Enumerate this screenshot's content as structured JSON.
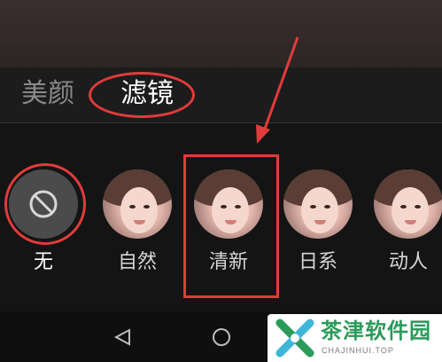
{
  "tabs": [
    {
      "label": "美颜",
      "active": false
    },
    {
      "label": "滤镜",
      "active": true
    }
  ],
  "filters": [
    {
      "label": "无",
      "type": "none",
      "selected": true
    },
    {
      "label": "自然",
      "type": "portrait"
    },
    {
      "label": "清新",
      "type": "portrait",
      "highlighted": true
    },
    {
      "label": "日系",
      "type": "portrait"
    },
    {
      "label": "动人",
      "type": "portrait"
    }
  ],
  "navigation": {
    "back_icon": "triangle-back-icon",
    "home_icon": "circle-home-icon"
  },
  "watermark": {
    "name": "茶津软件园",
    "domain": "CHAJINHUI.TOP"
  },
  "colors": {
    "annotation": "#e23b3b",
    "brand": "#2a9b5b"
  }
}
